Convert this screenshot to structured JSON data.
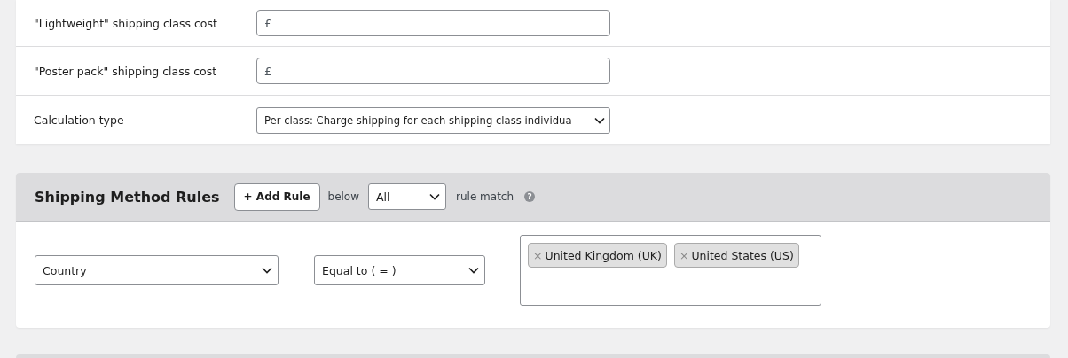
{
  "settings": [
    {
      "label": "\"Lightweight\" shipping class cost",
      "kind": "text",
      "placeholder": "£"
    },
    {
      "label": "\"Poster pack\" shipping class cost",
      "kind": "text",
      "placeholder": "£"
    },
    {
      "label": "Calculation type",
      "kind": "select",
      "value": "Per class: Charge shipping for each shipping class individua"
    }
  ],
  "rules_panel": {
    "title": "Shipping Method Rules",
    "add_button": "+ Add Rule",
    "before_select": "below",
    "match_select": "All",
    "after_select": "rule match",
    "help_icon": "?",
    "rules": [
      {
        "field": "Country",
        "operator": "Equal to ( = )",
        "values": [
          {
            "remove": "×",
            "label": "United Kingdom (UK)"
          },
          {
            "remove": "×",
            "label": "United States (US)"
          }
        ]
      }
    ]
  }
}
